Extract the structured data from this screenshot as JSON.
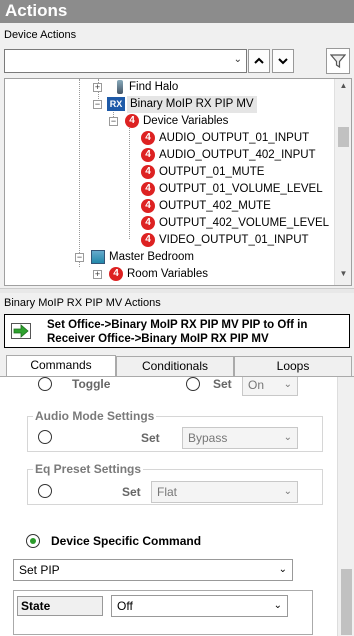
{
  "header": {
    "title": "Actions"
  },
  "device_actions": {
    "label": "Device Actions",
    "filter_value": "",
    "tree": [
      {
        "label": "Find Halo",
        "icon": "halo-device-icon"
      },
      {
        "label": "Binary MoIP RX PIP MV",
        "icon": "rx-device-icon",
        "selected": true
      },
      {
        "label": "Device Variables",
        "icon": "variable-icon"
      },
      {
        "label": "AUDIO_OUTPUT_01_INPUT",
        "icon": "variable-icon"
      },
      {
        "label": "AUDIO_OUTPUT_402_INPUT",
        "icon": "variable-icon"
      },
      {
        "label": "OUTPUT_01_MUTE",
        "icon": "variable-icon"
      },
      {
        "label": "OUTPUT_01_VOLUME_LEVEL",
        "icon": "variable-icon"
      },
      {
        "label": "OUTPUT_402_MUTE",
        "icon": "variable-icon"
      },
      {
        "label": "OUTPUT_402_VOLUME_LEVEL",
        "icon": "variable-icon"
      },
      {
        "label": "VIDEO_OUTPUT_01_INPUT",
        "icon": "variable-icon"
      },
      {
        "label": "Master Bedroom",
        "icon": "room-icon"
      },
      {
        "label": "Room Variables",
        "icon": "variable-icon"
      }
    ]
  },
  "actions_section": {
    "label": "Binary MoIP RX PIP MV Actions",
    "line1": "Set Office->Binary MoIP RX PIP MV PIP to  Off in",
    "line2": "Receiver Office->Binary MoIP RX PIP MV"
  },
  "tabs": [
    "Commands",
    "Conditionals",
    "Loops"
  ],
  "commands": {
    "toggle_label": "Toggle",
    "set_label": "Set",
    "set_value": "On",
    "audio_mode": {
      "title": "Audio Mode Settings",
      "set_label": "Set",
      "value": "Bypass"
    },
    "eq_preset": {
      "title": "Eq Preset Settings",
      "set_label": "Set",
      "value": "Flat"
    },
    "device_specific_label": "Device Specific Command",
    "command_value": "Set PIP",
    "state_label": "State",
    "state_value": "Off"
  }
}
